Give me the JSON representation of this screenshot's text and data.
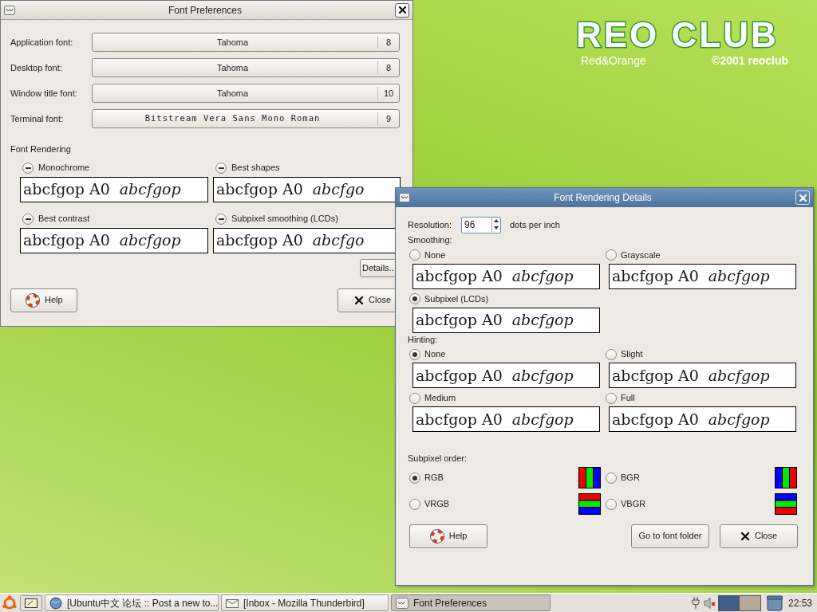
{
  "desktop": {
    "logo_title": "REO CLUB",
    "logo_tagline": "Red&Orange",
    "logo_copyright": "©2001 reoclub"
  },
  "font_preferences": {
    "title": "Font Preferences",
    "active": false,
    "fonts": [
      {
        "label": "Application font:",
        "family": "Tahoma",
        "size": "8",
        "kind": "sans"
      },
      {
        "label": "Desktop font:",
        "family": "Tahoma",
        "size": "8",
        "kind": "sans"
      },
      {
        "label": "Window title font:",
        "family": "Tahoma",
        "size": "10",
        "kind": "sans"
      },
      {
        "label": "Terminal font:",
        "family": "Bitstream Vera Sans Mono Roman",
        "size": "9",
        "kind": "mono"
      }
    ],
    "rendering_heading": "Font Rendering",
    "rendering_options": [
      {
        "label": "Monochrome",
        "inconsistent": true,
        "sample": "abcfgop A0",
        "sample_italic": "abcfgop"
      },
      {
        "label": "Best shapes",
        "inconsistent": true,
        "sample": "abcfgop A0",
        "sample_italic": "abcfgo"
      },
      {
        "label": "Best contrast",
        "inconsistent": true,
        "sample": "abcfgop A0",
        "sample_italic": "abcfgop"
      },
      {
        "label": "Subpixel smoothing (LCDs)",
        "inconsistent": true,
        "sample": "abcfgop A0",
        "sample_italic": "abcfgo"
      }
    ],
    "details_button": "Details..",
    "help_button": "Help",
    "close_button": "Close"
  },
  "details_dialog": {
    "title": "Font Rendering Details",
    "active": true,
    "resolution_label": "Resolution:",
    "resolution_value": "96",
    "resolution_unit": "dots per inch",
    "smoothing_heading": "Smoothing:",
    "smoothing_options": [
      {
        "label": "None",
        "selected": false,
        "sample": "abcfgop A0",
        "sample_italic": "abcfgop"
      },
      {
        "label": "Grayscale",
        "selected": false,
        "sample": "abcfgop A0",
        "sample_italic": "abcfgop"
      },
      {
        "label": "Subpixel (LCDs)",
        "selected": true,
        "sample": "abcfgop A0",
        "sample_italic": "abcfgop"
      }
    ],
    "hinting_heading": "Hinting:",
    "hinting_options": [
      {
        "label": "None",
        "selected": true,
        "sample": "abcfgop A0",
        "sample_italic": "abcfgop"
      },
      {
        "label": "Slight",
        "selected": false,
        "sample": "abcfgop A0",
        "sample_italic": "abcfgop"
      },
      {
        "label": "Medium",
        "selected": false,
        "sample": "abcfgop A0",
        "sample_italic": "abcfgop"
      },
      {
        "label": "Full",
        "selected": false,
        "sample": "abcfgop A0",
        "sample_italic": "abcfgop"
      }
    ],
    "subpixel_heading": "Subpixel order:",
    "subpixel_options": [
      {
        "label": "RGB",
        "selected": true,
        "kind": "rgb"
      },
      {
        "label": "BGR",
        "selected": false,
        "kind": "bgr"
      },
      {
        "label": "VRGB",
        "selected": false,
        "kind": "vrgb"
      },
      {
        "label": "VBGR",
        "selected": false,
        "kind": "vbgr"
      }
    ],
    "help_button": "Help",
    "folder_button": "Go to font folder",
    "close_button": "Close"
  },
  "taskbar": {
    "items": [
      {
        "label": "[Ubuntu中文  论坛  :: Post a new to...",
        "selected": false,
        "kind": "browser"
      },
      {
        "label": "[Inbox - Mozilla Thunderbird]",
        "selected": false,
        "kind": "mail"
      },
      {
        "label": "Font Preferences",
        "selected": true,
        "kind": "prefs"
      }
    ],
    "clock": "22:53"
  }
}
